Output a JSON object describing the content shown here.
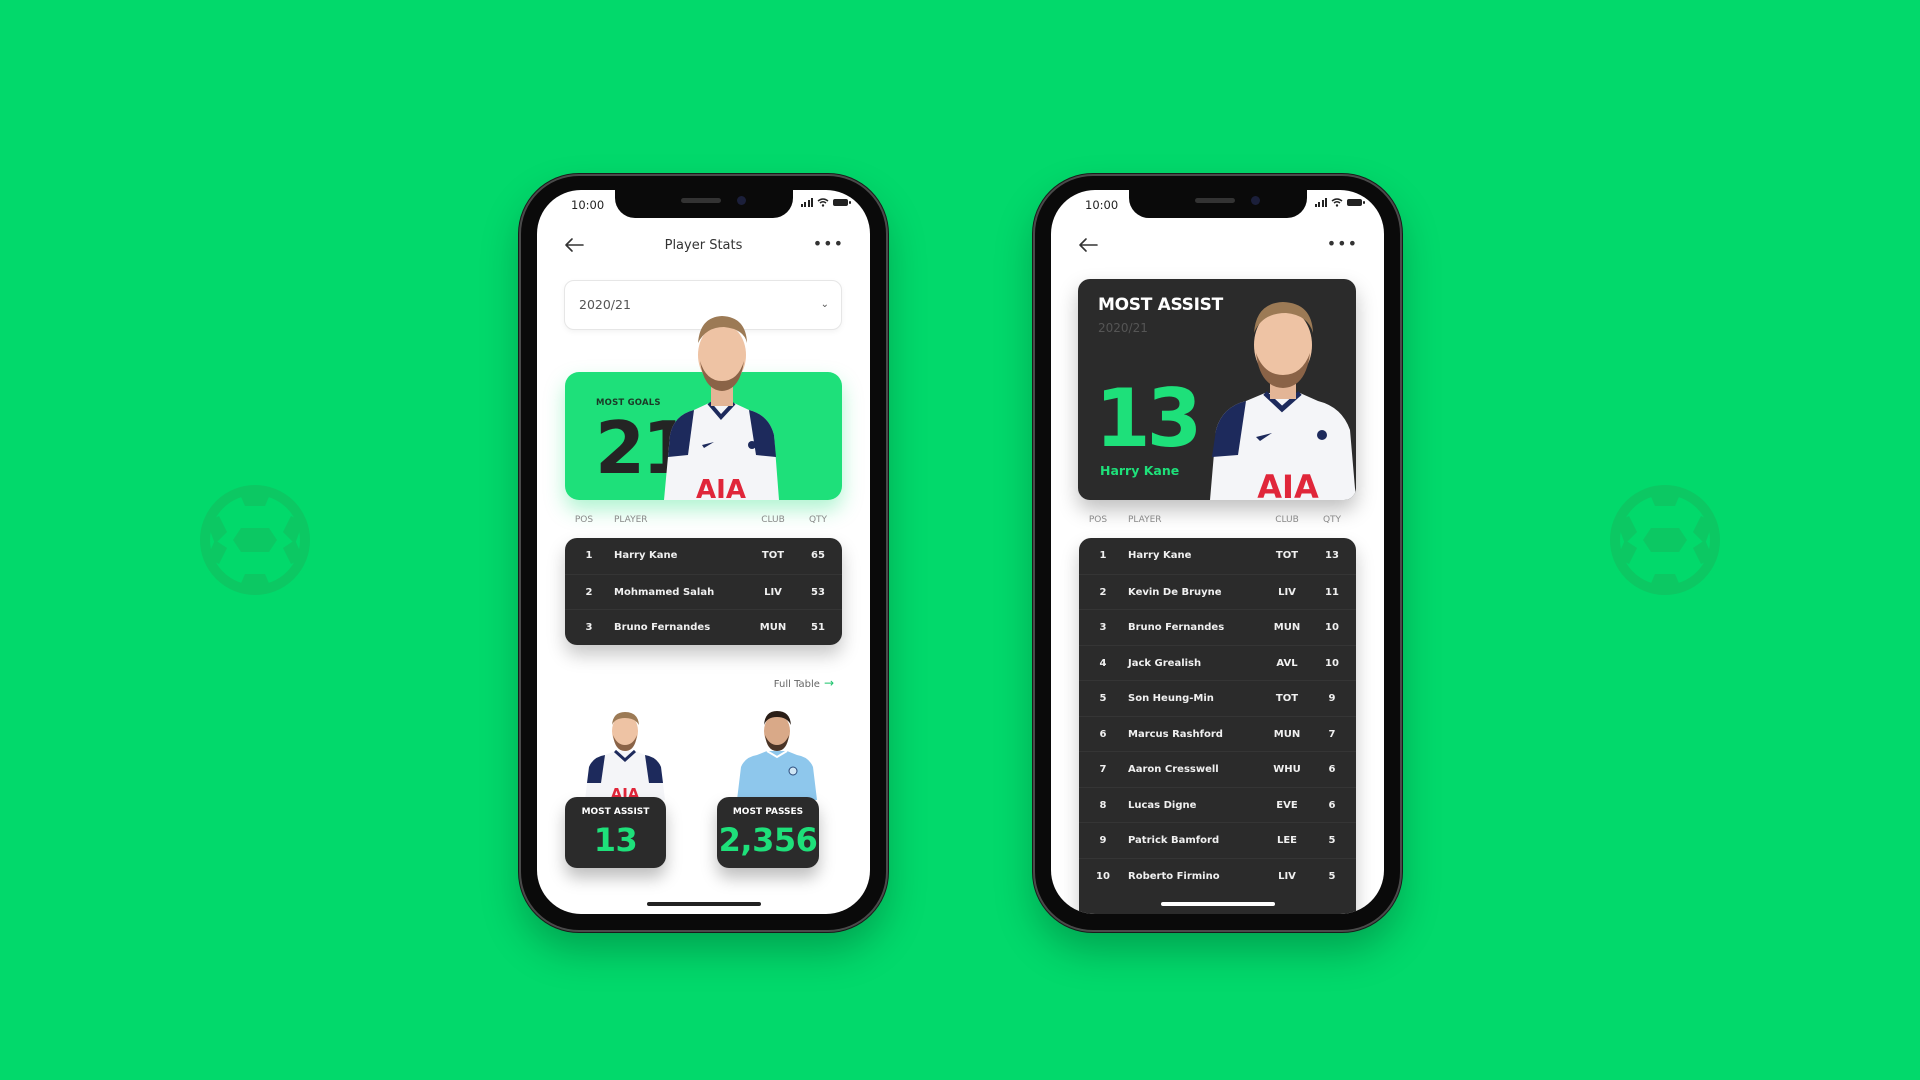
{
  "colors": {
    "background": "#02d96b",
    "accent_green": "#1ee07a",
    "dark_card": "#2b2b2b"
  },
  "decor": {
    "left_icon": "soccer-ball-icon",
    "right_icon": "soccer-ball-icon"
  },
  "phone_left": {
    "status": {
      "time": "10:00"
    },
    "header": {
      "back_icon": "arrow-left-icon",
      "title": "Player Stats",
      "more_icon": "more-horizontal-icon"
    },
    "season_select": {
      "value": "2020/21",
      "icon": "chevron-down-icon"
    },
    "most_goals": {
      "label": "MOST GOALS",
      "value": "21",
      "player_image": "Harry Kane"
    },
    "table": {
      "headers": {
        "pos": "POS",
        "player": "PLAYER",
        "club": "CLUB",
        "qty": "QTY"
      },
      "rows": [
        {
          "pos": "1",
          "player": "Harry Kane",
          "club": "TOT",
          "qty": "65"
        },
        {
          "pos": "2",
          "player": "Mohmamed Salah",
          "club": "LIV",
          "qty": "53"
        },
        {
          "pos": "3",
          "player": "Bruno Fernandes",
          "club": "MUN",
          "qty": "51"
        }
      ]
    },
    "full_table": {
      "label": "Full Table",
      "icon": "arrow-right-icon"
    },
    "most_assist": {
      "label": "MOST ASSIST",
      "value": "13"
    },
    "most_passes": {
      "label": "MOST PASSES",
      "value": "2,356"
    }
  },
  "phone_right": {
    "status": {
      "time": "10:00"
    },
    "header": {
      "back_icon": "arrow-left-icon",
      "more_icon": "more-horizontal-icon"
    },
    "hero": {
      "label": "MOST ASSIST",
      "season": "2020/21",
      "value": "13",
      "player": "Harry Kane"
    },
    "table": {
      "headers": {
        "pos": "POS",
        "player": "PLAYER",
        "club": "CLUB",
        "qty": "QTY"
      },
      "rows": [
        {
          "pos": "1",
          "player": "Harry Kane",
          "club": "TOT",
          "qty": "13"
        },
        {
          "pos": "2",
          "player": "Kevin De Bruyne",
          "club": "LIV",
          "qty": "11"
        },
        {
          "pos": "3",
          "player": "Bruno Fernandes",
          "club": "MUN",
          "qty": "10"
        },
        {
          "pos": "4",
          "player": "Jack Grealish",
          "club": "AVL",
          "qty": "10"
        },
        {
          "pos": "5",
          "player": "Son Heung-Min",
          "club": "TOT",
          "qty": "9"
        },
        {
          "pos": "6",
          "player": "Marcus Rashford",
          "club": "MUN",
          "qty": "7"
        },
        {
          "pos": "7",
          "player": "Aaron Cresswell",
          "club": "WHU",
          "qty": "6"
        },
        {
          "pos": "8",
          "player": "Lucas Digne",
          "club": "EVE",
          "qty": "6"
        },
        {
          "pos": "9",
          "player": "Patrick Bamford",
          "club": "LEE",
          "qty": "5"
        },
        {
          "pos": "10",
          "player": "Roberto Firmino",
          "club": "LIV",
          "qty": "5"
        }
      ]
    }
  }
}
